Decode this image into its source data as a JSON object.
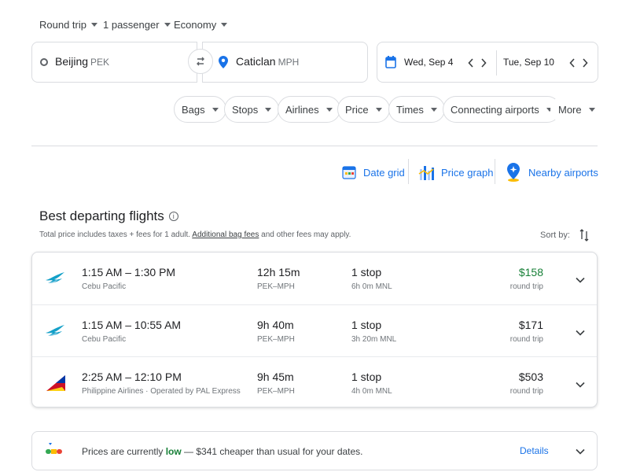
{
  "options": {
    "trip_type": "Round trip",
    "passengers": "1 passenger",
    "cabin": "Economy"
  },
  "search": {
    "origin_city": "Beijing",
    "origin_code": "PEK",
    "destination_city": "Caticlan",
    "destination_code": "MPH",
    "depart_date": "Wed, Sep 4",
    "return_date": "Tue, Sep 10"
  },
  "filters": [
    "Bags",
    "Stops",
    "Airlines",
    "Price",
    "Times",
    "Connecting airports",
    "More"
  ],
  "tools": {
    "date_grid": "Date grid",
    "price_graph": "Price graph",
    "nearby_airports": "Nearby airports"
  },
  "results": {
    "title": "Best departing flights",
    "note_prefix": "Total price includes taxes + fees for 1 adult. ",
    "note_link": "Additional bag fees",
    "note_suffix": " and other fees may apply.",
    "sort_label": "Sort by:",
    "flights": [
      {
        "times": "1:15 AM – 1:30 PM",
        "airline": "Cebu Pacific",
        "duration": "12h 15m",
        "route": "PEK–MPH",
        "stops": "1 stop",
        "layover": "6h 0m MNL",
        "price": "$158",
        "price_type": "round trip",
        "logo": "cebu-pacific-logo"
      },
      {
        "times": "1:15 AM – 10:55 AM",
        "airline": "Cebu Pacific",
        "duration": "9h 40m",
        "route": "PEK–MPH",
        "stops": "1 stop",
        "layover": "3h 20m MNL",
        "price": "$171",
        "price_type": "round trip",
        "logo": "cebu-pacific-logo"
      },
      {
        "times": "2:25 AM – 12:10 PM",
        "airline": "Philippine Airlines · Operated by PAL Express",
        "duration": "9h 45m",
        "route": "PEK–MPH",
        "stops": "1 stop",
        "layover": "4h 0m MNL",
        "price": "$503",
        "price_type": "round trip",
        "logo": "philippine-airlines-logo"
      }
    ]
  },
  "insight": {
    "prefix": "Prices are currently ",
    "level": "low",
    "suffix": " — $341 cheaper than usual for your dates.",
    "details": "Details"
  },
  "colors": {
    "accent": "#1a73e8",
    "low_price": "#188038",
    "border": "#dadce0"
  }
}
